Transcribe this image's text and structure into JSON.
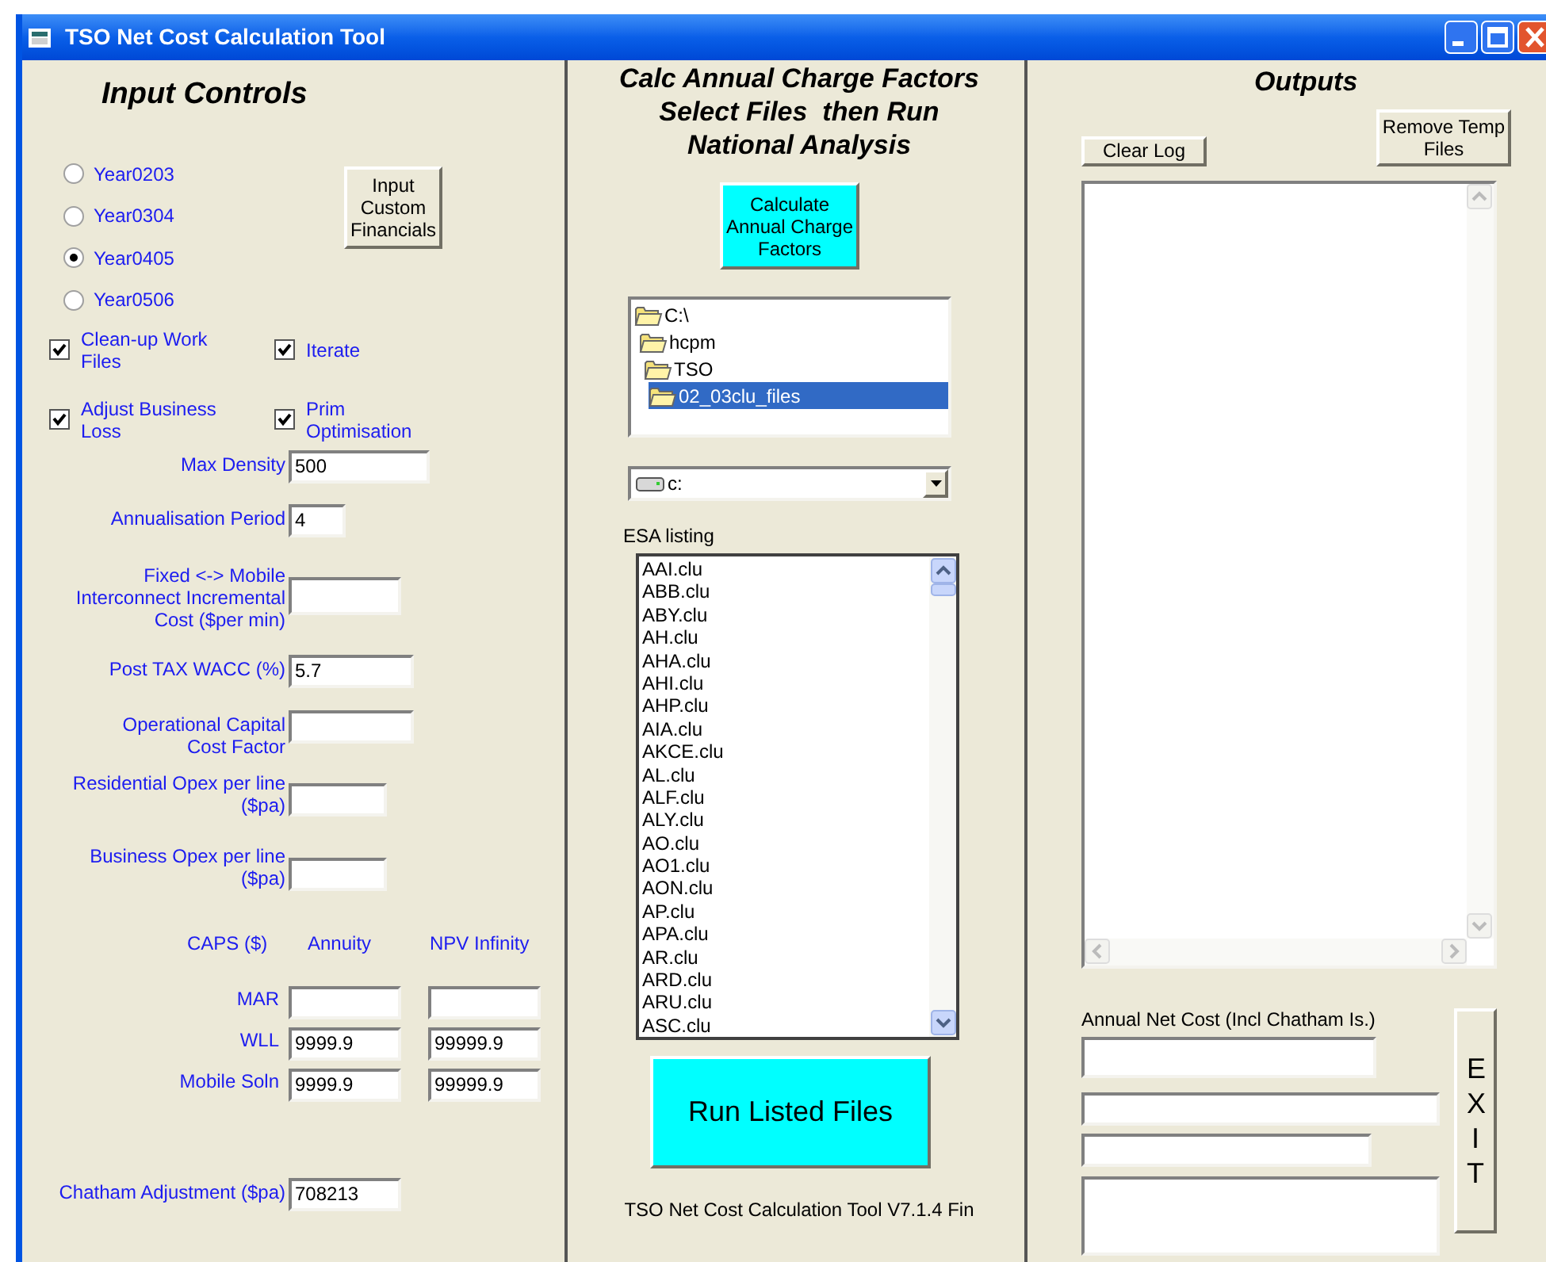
{
  "window": {
    "title": "TSO Net Cost Calculation Tool"
  },
  "input_controls": {
    "title": "Input Controls",
    "years": [
      {
        "label": "Year0203",
        "selected": false
      },
      {
        "label": "Year0304",
        "selected": false
      },
      {
        "label": "Year0405",
        "selected": true
      },
      {
        "label": "Year0506",
        "selected": false
      }
    ],
    "custom_button": "Input Custom Financials",
    "options": [
      {
        "label": "Clean-up Work Files",
        "checked": true
      },
      {
        "label": "Iterate",
        "checked": true
      },
      {
        "label": "Adjust Business Loss",
        "checked": true
      },
      {
        "label": "Prim Optimisation",
        "checked": true
      }
    ],
    "fields": [
      {
        "label": "Max Density",
        "value": "500"
      },
      {
        "label": "Annualisation Period",
        "value": "4"
      },
      {
        "label": "Fixed <-> Mobile Interconnect Incremental Cost ($per min)"
      },
      {
        "label": "Post TAX WACC (%)",
        "value": "5.7"
      },
      {
        "label": "Operational Capital Cost Factor"
      },
      {
        "label": "Residential Opex per line ($pa)"
      },
      {
        "label": "Business Opex per line ($pa)"
      }
    ],
    "caps": {
      "columns": [
        "CAPS ($)",
        "Annuity",
        "NPV Infinity"
      ],
      "rows": [
        {
          "label": "MAR"
        },
        {
          "label": "WLL",
          "annuity": "9999.9",
          "npv_infinity": "99999.9"
        },
        {
          "label": "Mobile Soln",
          "annuity": "9999.9",
          "npv_infinity": "99999.9"
        }
      ]
    },
    "chatham": {
      "label": "Chatham Adjustment ($pa)",
      "value": "708213"
    }
  },
  "analysis": {
    "title_lines": [
      "Calc Annual Charge Factors",
      "Select Files  then Run",
      "National Analysis"
    ],
    "calculate_button": "Calculate Annual Charge Factors",
    "folders": [
      {
        "name": "C:\\",
        "selected": false,
        "children": [
          {
            "name": "hcpm",
            "selected": false,
            "children": [
              {
                "name": "TSO",
                "selected": false,
                "children": [
                  {
                    "name": "02_03clu_files",
                    "selected": true
                  }
                ]
              }
            ]
          }
        ]
      }
    ],
    "drive": "c:",
    "esa_label": "ESA listing",
    "esa_files": [
      "AAI.clu",
      "ABB.clu",
      "ABY.clu",
      "AH.clu",
      "AHA.clu",
      "AHI.clu",
      "AHP.clu",
      "AIA.clu",
      "AKCE.clu",
      "AL.clu",
      "ALF.clu",
      "ALY.clu",
      "AO.clu",
      "AO1.clu",
      "AON.clu",
      "AP.clu",
      "APA.clu",
      "AR.clu",
      "ARD.clu",
      "ARU.clu",
      "ASC.clu"
    ],
    "run_button": "Run Listed Files",
    "version": "TSO Net Cost Calculation Tool V7.1.4 Fin"
  },
  "outputs": {
    "title": "Outputs",
    "clear_button": "Clear Log",
    "remove_button": "Remove Temp Files",
    "net_cost_label": "Annual Net Cost (Incl Chatham Is.)",
    "exit_button": "EXIT"
  }
}
